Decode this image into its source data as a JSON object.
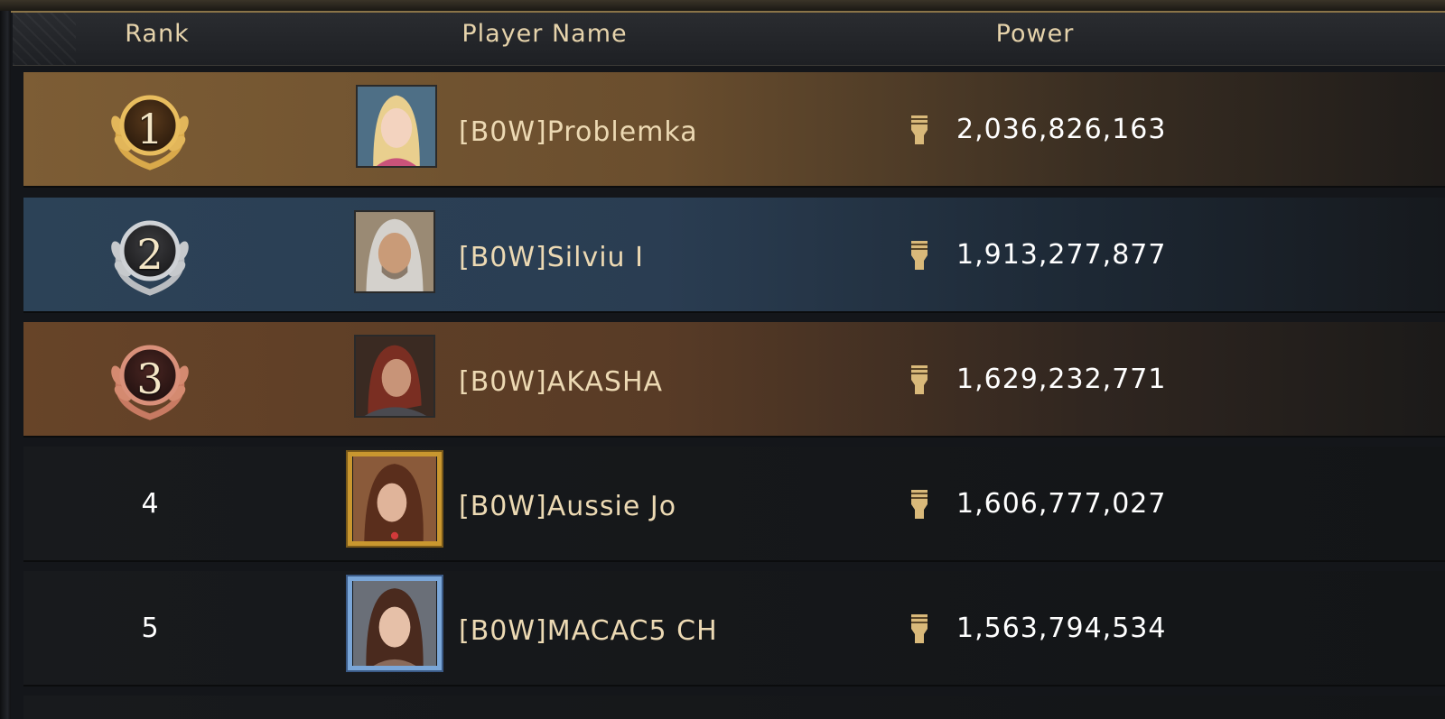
{
  "header": {
    "rank_label": "Rank",
    "player_name_label": "Player Name",
    "power_label": "Power"
  },
  "rows": [
    {
      "rank": "1",
      "name": "[B0W]Problemka",
      "power": "2,036,826,163",
      "tier": "gold",
      "avatar_frame": "none"
    },
    {
      "rank": "2",
      "name": "[B0W]Silviu I",
      "power": "1,913,277,877",
      "tier": "silver",
      "avatar_frame": "none"
    },
    {
      "rank": "3",
      "name": "[B0W]AKASHA",
      "power": "1,629,232,771",
      "tier": "bronze",
      "avatar_frame": "none"
    },
    {
      "rank": "4",
      "name": "[B0W]Aussie Jo",
      "power": "1,606,777,027",
      "tier": "plain",
      "avatar_frame": "gold"
    },
    {
      "rank": "5",
      "name": "[B0W]MACAC5 CH",
      "power": "1,563,794,534",
      "tier": "plain",
      "avatar_frame": "blue"
    }
  ],
  "icons": {
    "medal": "laurel-medal-icon",
    "power": "fist-power-icon"
  },
  "colors": {
    "gold_row": "#7d5d35",
    "silver_row": "#2c4257",
    "bronze_row": "#674428",
    "header_text": "#e6d3ab",
    "name_text": "#ecd9b3"
  }
}
